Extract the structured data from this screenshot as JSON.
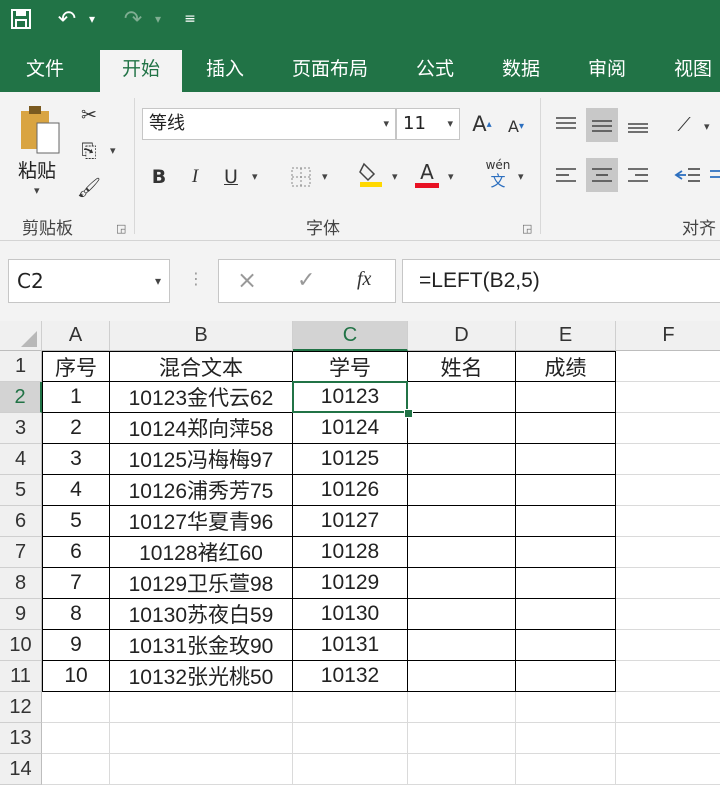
{
  "quick_access": {
    "save_icon": "save-icon",
    "undo_icon": "undo-icon",
    "redo_icon": "redo-icon",
    "customize_icon": "customize-icon"
  },
  "tabs": [
    "文件",
    "开始",
    "插入",
    "页面布局",
    "公式",
    "数据",
    "审阅",
    "视图"
  ],
  "active_tab": "开始",
  "clipboard": {
    "paste_label": "粘贴",
    "group_label": "剪贴板"
  },
  "font": {
    "name": "等线",
    "size": "11",
    "bold": "B",
    "italic": "I",
    "underline": "U",
    "group_label": "字体",
    "font_color_letter": "A",
    "grow": "A",
    "shrink": "A",
    "phonetic_top": "wén",
    "phonetic_bottom": "文"
  },
  "alignment": {
    "group_label": "对齐"
  },
  "formula_bar": {
    "name_box": "C2",
    "cancel": "×",
    "enter": "✓",
    "fx": "fx",
    "formula": "=LEFT(B2,5)"
  },
  "colors": {
    "accent": "#217346",
    "font_color": "#e81123",
    "fill_color": "#ffd800"
  },
  "sheet": {
    "columns": [
      "A",
      "B",
      "C",
      "D",
      "E",
      "F"
    ],
    "selected_column": "C",
    "selected_row": "2",
    "rows": [
      {
        "num": "1",
        "cells": [
          "序号",
          "混合文本",
          "学号",
          "姓名",
          "成绩",
          ""
        ]
      },
      {
        "num": "2",
        "cells": [
          "1",
          "10123金代云62",
          "10123",
          "",
          "",
          ""
        ]
      },
      {
        "num": "3",
        "cells": [
          "2",
          "10124郑向萍58",
          "10124",
          "",
          "",
          ""
        ]
      },
      {
        "num": "4",
        "cells": [
          "3",
          "10125冯梅梅97",
          "10125",
          "",
          "",
          ""
        ]
      },
      {
        "num": "5",
        "cells": [
          "4",
          "10126浦秀芳75",
          "10126",
          "",
          "",
          ""
        ]
      },
      {
        "num": "6",
        "cells": [
          "5",
          "10127华夏青96",
          "10127",
          "",
          "",
          ""
        ]
      },
      {
        "num": "7",
        "cells": [
          "6",
          "10128褚红60",
          "10128",
          "",
          "",
          ""
        ]
      },
      {
        "num": "8",
        "cells": [
          "7",
          "10129卫乐萱98",
          "10129",
          "",
          "",
          ""
        ]
      },
      {
        "num": "9",
        "cells": [
          "8",
          "10130苏夜白59",
          "10130",
          "",
          "",
          ""
        ]
      },
      {
        "num": "10",
        "cells": [
          "9",
          "10131张金玫90",
          "10131",
          "",
          "",
          ""
        ]
      },
      {
        "num": "11",
        "cells": [
          "10",
          "10132张光桃50",
          "10132",
          "",
          "",
          ""
        ]
      },
      {
        "num": "12",
        "cells": [
          "",
          "",
          "",
          "",
          "",
          ""
        ]
      },
      {
        "num": "13",
        "cells": [
          "",
          "",
          "",
          "",
          "",
          ""
        ]
      },
      {
        "num": "14",
        "cells": [
          "",
          "",
          "",
          "",
          "",
          ""
        ]
      }
    ]
  }
}
